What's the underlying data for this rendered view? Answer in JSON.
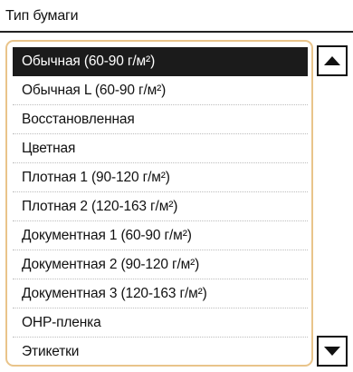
{
  "header": {
    "title": "Тип бумаги"
  },
  "paper_list": {
    "items": [
      {
        "label": "Обычная (60-90 г/м²)"
      },
      {
        "label": "Обычная L (60-90 г/м²)"
      },
      {
        "label": "Восстановленная"
      },
      {
        "label": "Цветная"
      },
      {
        "label": "Плотная 1 (90-120 г/м²)"
      },
      {
        "label": "Плотная 2 (120-163 г/м²)"
      },
      {
        "label": "Документная 1 (60-90 г/м²)"
      },
      {
        "label": "Документная 2 (90-120 г/м²)"
      },
      {
        "label": "Документная 3 (120-163 г/м²)"
      },
      {
        "label": "ОНР-пленка"
      },
      {
        "label": "Этикетки"
      }
    ],
    "selected_index": 0
  },
  "scrollbar": {
    "up_icon": "arrow-up-icon",
    "down_icon": "arrow-down-icon"
  },
  "colors": {
    "selection_background": "#1b1b1b",
    "focus_border": "#e9c48a"
  }
}
